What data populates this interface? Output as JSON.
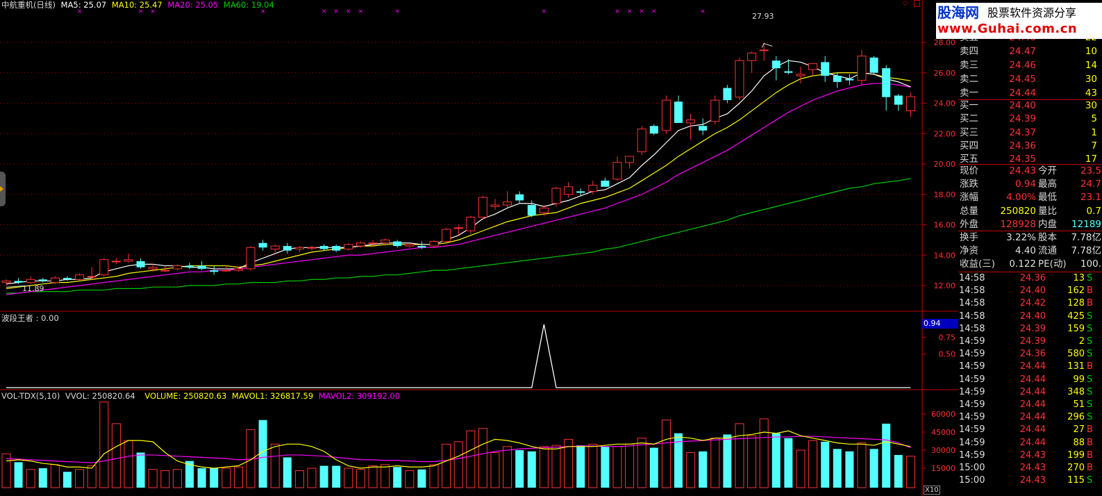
{
  "header": {
    "title": "中航重机(日线)",
    "ma5": "MA5: 25.07",
    "ma10": "MA10: 25.47",
    "ma20": "MA20: 25.05",
    "ma60": "MA60: 19.04"
  },
  "colors": {
    "up": "#ff3333",
    "down": "#54ffff",
    "ma5": "#ffffff",
    "ma10": "#ffff00",
    "ma20": "#ff00ff",
    "ma60": "#00cc00",
    "grid": "#c00000"
  },
  "price_axis": [
    "28.00",
    "26.00",
    "24.00",
    "22.00",
    "20.00",
    "18.00",
    "16.00",
    "14.00",
    "12.00"
  ],
  "annotations": {
    "high_label": "27.93",
    "low_label": "11.89"
  },
  "indicator": {
    "title": "波段王者 : 0.00",
    "value_box": "0.94",
    "axis": [
      "0.75",
      "0.50"
    ]
  },
  "volume": {
    "title": "VOL-TDX(5,10)",
    "vvol": "VVOL: 250820.64",
    "volume": "VOLUME: 250820.63",
    "mavol1": "MAVOL1: 326817.59",
    "mavol2": "MAVOL2: 309192.00",
    "axis": [
      "60000",
      "45000",
      "30000",
      "15000"
    ],
    "unit": "X10"
  },
  "banner": {
    "logo": "股海网",
    "slogan": "股票软件资源分享",
    "url": "www.Guhai.com.cn"
  },
  "orderbook": {
    "sell": [
      {
        "label": "卖五",
        "price": "24.48",
        "vol": "22"
      },
      {
        "label": "卖四",
        "price": "24.47",
        "vol": "10"
      },
      {
        "label": "卖三",
        "price": "24.46",
        "vol": "14"
      },
      {
        "label": "卖二",
        "price": "24.45",
        "vol": "30"
      },
      {
        "label": "卖一",
        "price": "24.44",
        "vol": "43"
      }
    ],
    "buy": [
      {
        "label": "买一",
        "price": "24.40",
        "vol": "30"
      },
      {
        "label": "买二",
        "price": "24.39",
        "vol": "5"
      },
      {
        "label": "买三",
        "price": "24.37",
        "vol": "1"
      },
      {
        "label": "买四",
        "price": "24.36",
        "vol": "7"
      },
      {
        "label": "买五",
        "price": "24.35",
        "vol": "17"
      }
    ]
  },
  "quote": [
    {
      "l1": "现价",
      "v1": "24.43",
      "c1": "#ff3333",
      "l2": "今开",
      "v2": "23.5",
      "c2": "#ff3333"
    },
    {
      "l1": "涨跌",
      "v1": "0.94",
      "c1": "#ff3333",
      "l2": "最高",
      "v2": "24.7",
      "c2": "#ff3333"
    },
    {
      "l1": "涨幅",
      "v1": "4.00%",
      "c1": "#ff3333",
      "l2": "最低",
      "v2": "23.1",
      "c2": "#ff3333"
    },
    {
      "l1": "总量",
      "v1": "250820",
      "c1": "#ffff00",
      "l2": "量比",
      "v2": "0.7",
      "c2": "#ffff00"
    },
    {
      "l1": "外盘",
      "v1": "128928",
      "c1": "#ff3333",
      "l2": "内盘",
      "v2": "12189",
      "c2": "#54ffff"
    }
  ],
  "fundamentals": [
    {
      "l1": "换手",
      "v1": "3.22%",
      "l2": "股本",
      "v2": "7.78亿"
    },
    {
      "l1": "净资",
      "v1": "4.40",
      "l2": "流通",
      "v2": "7.78亿"
    },
    {
      "l1": "收益(三)",
      "v1": "0.122",
      "l2": "PE(动)",
      "v2": "100."
    }
  ],
  "ticks": [
    {
      "time": "14:58",
      "price": "24.36",
      "vol": "13",
      "side": "S"
    },
    {
      "time": "14:58",
      "price": "24.40",
      "vol": "162",
      "side": "B"
    },
    {
      "time": "14:58",
      "price": "24.42",
      "vol": "128",
      "side": "B"
    },
    {
      "time": "14:58",
      "price": "24.40",
      "vol": "425",
      "side": "S"
    },
    {
      "time": "14:58",
      "price": "24.39",
      "vol": "159",
      "side": "S"
    },
    {
      "time": "14:59",
      "price": "24.39",
      "vol": "2",
      "side": "S"
    },
    {
      "time": "14:59",
      "price": "24.36",
      "vol": "580",
      "side": "S"
    },
    {
      "time": "14:59",
      "price": "24.44",
      "vol": "131",
      "side": "B"
    },
    {
      "time": "14:59",
      "price": "24.44",
      "vol": "99",
      "side": "S"
    },
    {
      "time": "14:59",
      "price": "24.44",
      "vol": "348",
      "side": "S"
    },
    {
      "time": "14:59",
      "price": "24.44",
      "vol": "51",
      "side": "S"
    },
    {
      "time": "14:59",
      "price": "24.44",
      "vol": "296",
      "side": "S"
    },
    {
      "time": "14:59",
      "price": "24.44",
      "vol": "27",
      "side": "B"
    },
    {
      "time": "14:59",
      "price": "24.44",
      "vol": "88",
      "side": "B"
    },
    {
      "time": "14:59",
      "price": "24.43",
      "vol": "199",
      "side": "B"
    },
    {
      "time": "15:00",
      "price": "24.43",
      "vol": "270",
      "side": "B"
    },
    {
      "time": "15:00",
      "price": "24.43",
      "vol": "115",
      "side": "S"
    }
  ],
  "chart_data": {
    "type": "candlestick",
    "ylim": [
      11,
      29
    ],
    "candles": [
      [
        12.2,
        12.4,
        12.0,
        12.3
      ],
      [
        12.3,
        12.5,
        12.1,
        12.2
      ],
      [
        12.2,
        12.6,
        12.1,
        12.4
      ],
      [
        12.4,
        12.5,
        12.2,
        12.3
      ],
      [
        12.2,
        12.6,
        12.1,
        12.5
      ],
      [
        12.5,
        12.6,
        12.3,
        12.4
      ],
      [
        12.4,
        12.8,
        12.3,
        12.7
      ],
      [
        12.6,
        13.2,
        12.4,
        12.6
      ],
      [
        12.7,
        13.8,
        12.6,
        13.7
      ],
      [
        13.6,
        13.8,
        13.4,
        13.6
      ],
      [
        13.6,
        14.1,
        13.5,
        13.7
      ],
      [
        13.6,
        13.8,
        13.1,
        13.2
      ],
      [
        13.1,
        13.4,
        12.9,
        13.2
      ],
      [
        13.0,
        13.3,
        12.9,
        13.0
      ],
      [
        13.1,
        13.4,
        13.0,
        13.3
      ],
      [
        13.3,
        13.5,
        13.1,
        13.2
      ],
      [
        13.3,
        13.6,
        13.0,
        13.1
      ],
      [
        13.0,
        13.3,
        12.7,
        12.9
      ],
      [
        13.0,
        13.3,
        12.9,
        13.0
      ],
      [
        13.0,
        13.2,
        12.9,
        13.1
      ],
      [
        13.1,
        14.6,
        13.0,
        14.5
      ],
      [
        14.8,
        15.0,
        14.3,
        14.5
      ],
      [
        14.4,
        14.7,
        14.1,
        14.6
      ],
      [
        14.6,
        14.8,
        14.1,
        14.3
      ],
      [
        14.4,
        14.6,
        14.2,
        14.5
      ],
      [
        14.5,
        14.6,
        14.3,
        14.5
      ],
      [
        14.6,
        14.7,
        14.3,
        14.4
      ],
      [
        14.6,
        14.7,
        14.2,
        14.3
      ],
      [
        14.4,
        14.8,
        14.3,
        14.7
      ],
      [
        14.6,
        14.9,
        14.5,
        14.8
      ],
      [
        14.8,
        15.0,
        14.6,
        14.8
      ],
      [
        14.8,
        15.1,
        14.6,
        15.0
      ],
      [
        14.9,
        15.0,
        14.5,
        14.6
      ],
      [
        14.6,
        14.8,
        14.5,
        14.7
      ],
      [
        14.6,
        14.9,
        14.4,
        14.5
      ],
      [
        14.6,
        15.0,
        14.5,
        14.9
      ],
      [
        14.9,
        15.8,
        14.8,
        15.7
      ],
      [
        15.8,
        16.0,
        15.3,
        15.8
      ],
      [
        15.6,
        16.6,
        15.4,
        16.5
      ],
      [
        16.5,
        17.9,
        16.3,
        17.8
      ],
      [
        17.2,
        17.7,
        17.0,
        17.3
      ],
      [
        17.3,
        18.2,
        17.1,
        17.5
      ],
      [
        18.0,
        18.2,
        17.4,
        17.6
      ],
      [
        17.3,
        17.6,
        16.5,
        16.6
      ],
      [
        16.8,
        17.3,
        16.6,
        17.1
      ],
      [
        17.4,
        18.5,
        17.2,
        18.4
      ],
      [
        18.0,
        18.8,
        17.8,
        18.5
      ],
      [
        18.2,
        18.4,
        17.9,
        18.1
      ],
      [
        18.2,
        18.9,
        18.0,
        18.6
      ],
      [
        18.9,
        19.1,
        18.5,
        18.5
      ],
      [
        19.0,
        20.5,
        18.9,
        20.1
      ],
      [
        20.1,
        20.5,
        19.7,
        20.5
      ],
      [
        20.8,
        22.5,
        20.6,
        22.3
      ],
      [
        22.5,
        22.6,
        21.9,
        22.0
      ],
      [
        22.2,
        24.5,
        22.0,
        24.2
      ],
      [
        24.1,
        24.5,
        22.7,
        22.7
      ],
      [
        22.7,
        23.3,
        21.6,
        22.9
      ],
      [
        22.5,
        23.0,
        21.9,
        22.2
      ],
      [
        22.8,
        24.5,
        22.6,
        24.2
      ],
      [
        25.0,
        25.2,
        24.0,
        24.2
      ],
      [
        24.4,
        27.0,
        24.2,
        26.8
      ],
      [
        26.8,
        27.4,
        26.0,
        27.3
      ],
      [
        27.5,
        27.93,
        26.8,
        27.5
      ],
      [
        26.8,
        27.1,
        25.5,
        26.3
      ],
      [
        26.1,
        26.9,
        25.9,
        26.0
      ],
      [
        25.8,
        26.4,
        25.3,
        25.9
      ],
      [
        26.2,
        26.6,
        25.8,
        26.6
      ],
      [
        26.7,
        27.1,
        25.4,
        25.8
      ],
      [
        25.8,
        26.0,
        25.0,
        25.4
      ],
      [
        25.6,
        25.9,
        25.2,
        25.5
      ],
      [
        25.5,
        27.5,
        25.2,
        27.1
      ],
      [
        27.0,
        27.1,
        25.9,
        26.0
      ],
      [
        26.3,
        26.5,
        23.5,
        24.4
      ],
      [
        24.5,
        24.6,
        23.5,
        23.9
      ],
      [
        23.5,
        24.7,
        23.1,
        24.43
      ]
    ],
    "ma5": [
      12.1,
      12.2,
      12.3,
      12.3,
      12.3,
      12.4,
      12.4,
      12.5,
      12.9,
      13.1,
      13.3,
      13.4,
      13.4,
      13.3,
      13.3,
      13.2,
      13.2,
      13.1,
      13.1,
      13.1,
      13.5,
      13.8,
      14.1,
      14.4,
      14.5,
      14.5,
      14.5,
      14.5,
      14.5,
      14.6,
      14.7,
      14.8,
      14.8,
      14.8,
      14.7,
      14.7,
      15.0,
      15.3,
      15.8,
      16.4,
      16.7,
      17.1,
      17.4,
      17.4,
      17.2,
      17.4,
      17.6,
      17.9,
      18.2,
      18.3,
      18.7,
      19.1,
      19.9,
      20.6,
      21.4,
      22.2,
      22.5,
      22.6,
      23.0,
      23.3,
      24.0,
      24.8,
      25.8,
      26.4,
      26.8,
      26.7,
      26.4,
      26.0,
      25.8,
      25.6,
      26.0,
      25.9,
      25.6,
      25.4,
      25.07
    ],
    "ma10": [
      11.8,
      11.9,
      12.0,
      12.1,
      12.2,
      12.2,
      12.3,
      12.4,
      12.5,
      12.6,
      12.8,
      12.9,
      13.0,
      13.1,
      13.2,
      13.3,
      13.3,
      13.3,
      13.3,
      13.2,
      13.3,
      13.4,
      13.6,
      13.8,
      14.0,
      14.2,
      14.3,
      14.4,
      14.5,
      14.6,
      14.6,
      14.7,
      14.7,
      14.7,
      14.7,
      14.7,
      14.8,
      15.0,
      15.3,
      15.6,
      15.9,
      16.2,
      16.4,
      16.6,
      16.7,
      16.8,
      17.1,
      17.4,
      17.6,
      17.8,
      18.1,
      18.4,
      18.9,
      19.4,
      19.9,
      20.5,
      21.0,
      21.5,
      22.0,
      22.4,
      22.9,
      23.5,
      24.1,
      24.7,
      25.2,
      25.6,
      25.8,
      25.9,
      26.0,
      26.0,
      26.0,
      25.9,
      25.7,
      25.6,
      25.47
    ],
    "ma20": [
      11.4,
      11.5,
      11.6,
      11.7,
      11.8,
      11.9,
      12.0,
      12.1,
      12.2,
      12.3,
      12.4,
      12.5,
      12.6,
      12.7,
      12.8,
      12.9,
      12.9,
      13.0,
      13.0,
      13.1,
      13.2,
      13.3,
      13.4,
      13.5,
      13.6,
      13.7,
      13.8,
      13.9,
      14.0,
      14.0,
      14.1,
      14.2,
      14.3,
      14.4,
      14.5,
      14.5,
      14.6,
      14.7,
      14.9,
      15.1,
      15.3,
      15.5,
      15.7,
      15.9,
      16.1,
      16.3,
      16.5,
      16.7,
      16.9,
      17.1,
      17.4,
      17.7,
      18.0,
      18.4,
      18.8,
      19.3,
      19.7,
      20.1,
      20.5,
      20.9,
      21.4,
      21.9,
      22.4,
      22.9,
      23.4,
      23.8,
      24.2,
      24.5,
      24.8,
      25.0,
      25.2,
      25.3,
      25.3,
      25.2,
      25.05
    ],
    "ma60": [
      11.5,
      11.5,
      11.6,
      11.6,
      11.6,
      11.6,
      11.7,
      11.7,
      11.7,
      11.8,
      11.8,
      11.8,
      11.9,
      11.9,
      11.9,
      12.0,
      12.0,
      12.0,
      12.1,
      12.1,
      12.2,
      12.2,
      12.2,
      12.3,
      12.3,
      12.4,
      12.4,
      12.5,
      12.5,
      12.6,
      12.6,
      12.7,
      12.7,
      12.8,
      12.9,
      13.0,
      13.0,
      13.1,
      13.2,
      13.3,
      13.4,
      13.5,
      13.6,
      13.7,
      13.8,
      13.9,
      14.0,
      14.1,
      14.2,
      14.4,
      14.5,
      14.7,
      14.9,
      15.1,
      15.3,
      15.5,
      15.7,
      15.9,
      16.1,
      16.3,
      16.6,
      16.8,
      17.0,
      17.2,
      17.4,
      17.6,
      17.8,
      18.0,
      18.2,
      18.4,
      18.5,
      18.7,
      18.8,
      18.9,
      19.04
    ],
    "volumes": [
      27000,
      20000,
      14000,
      15000,
      18000,
      12000,
      14000,
      17000,
      70000,
      52000,
      38000,
      28000,
      14000,
      13000,
      14000,
      21000,
      15000,
      15000,
      15000,
      16000,
      47000,
      55000,
      35000,
      24000,
      13000,
      15000,
      17000,
      17000,
      15000,
      14000,
      17000,
      18000,
      16000,
      13000,
      14000,
      18000,
      35000,
      37000,
      46000,
      48000,
      28000,
      33000,
      30000,
      29000,
      33000,
      34000,
      39000,
      34000,
      35000,
      33000,
      33000,
      35000,
      40000,
      32000,
      55000,
      44000,
      28000,
      29000,
      40000,
      43000,
      52000,
      42000,
      56000,
      44000,
      40000,
      30000,
      38000,
      37000,
      31000,
      29000,
      36000,
      31000,
      52000,
      26000,
      25000
    ],
    "mavol1": [
      21000,
      22000,
      21000,
      19000,
      18000,
      16000,
      16000,
      15000,
      27000,
      33000,
      38000,
      38000,
      37000,
      28000,
      21000,
      18000,
      16000,
      15000,
      16000,
      17000,
      22000,
      29000,
      33000,
      35000,
      35000,
      33000,
      29000,
      22000,
      17000,
      15000,
      16000,
      16000,
      17000,
      16000,
      16000,
      17000,
      21000,
      25000,
      30000,
      35000,
      39000,
      38000,
      36000,
      33000,
      31000,
      31000,
      33000,
      33000,
      33000,
      34000,
      35000,
      35000,
      36000,
      35000,
      39000,
      41000,
      40000,
      38000,
      40000,
      40000,
      42000,
      43000,
      45000,
      44000,
      46000,
      42000,
      40000,
      38000,
      36000,
      35000,
      35000,
      34000,
      37000,
      35000,
      33000
    ],
    "mavol2": [
      23000,
      22500,
      22000,
      21500,
      21000,
      20500,
      20000,
      19500,
      21000,
      23000,
      25000,
      26000,
      26000,
      25500,
      25000,
      24500,
      24000,
      23500,
      23000,
      22000,
      22500,
      24000,
      25000,
      26000,
      26000,
      25500,
      25000,
      24000,
      23000,
      22000,
      22000,
      21500,
      21500,
      21000,
      20500,
      20500,
      21500,
      23000,
      25000,
      27000,
      29000,
      30000,
      31000,
      31500,
      32000,
      32500,
      33000,
      33500,
      33500,
      33000,
      33000,
      33500,
      34500,
      35000,
      36000,
      37000,
      37500,
      38000,
      38500,
      39000,
      39500,
      40000,
      40500,
      41000,
      41000,
      41500,
      41500,
      41000,
      40500,
      40000,
      39500,
      39000,
      38500,
      36000,
      32000
    ],
    "signal": [
      0,
      0,
      0,
      0,
      0,
      0,
      0,
      0,
      0,
      0,
      0,
      0,
      0,
      0,
      0,
      0,
      0,
      0,
      0,
      0,
      0,
      0,
      0,
      0,
      0,
      0,
      0,
      0,
      0,
      0,
      0,
      0,
      0,
      0,
      0,
      0,
      0,
      0,
      0,
      0,
      0,
      0,
      0,
      0,
      1,
      0,
      0,
      0,
      0,
      0,
      0,
      0,
      0,
      0,
      0,
      0,
      0,
      0,
      0,
      0,
      0,
      0,
      0,
      0,
      0,
      0,
      0,
      0,
      0,
      0,
      0,
      0,
      0,
      0,
      0
    ],
    "signal_marks": [
      1,
      6,
      7,
      16,
      21,
      22,
      23,
      24,
      27,
      39,
      45,
      46,
      47,
      48,
      52
    ]
  }
}
